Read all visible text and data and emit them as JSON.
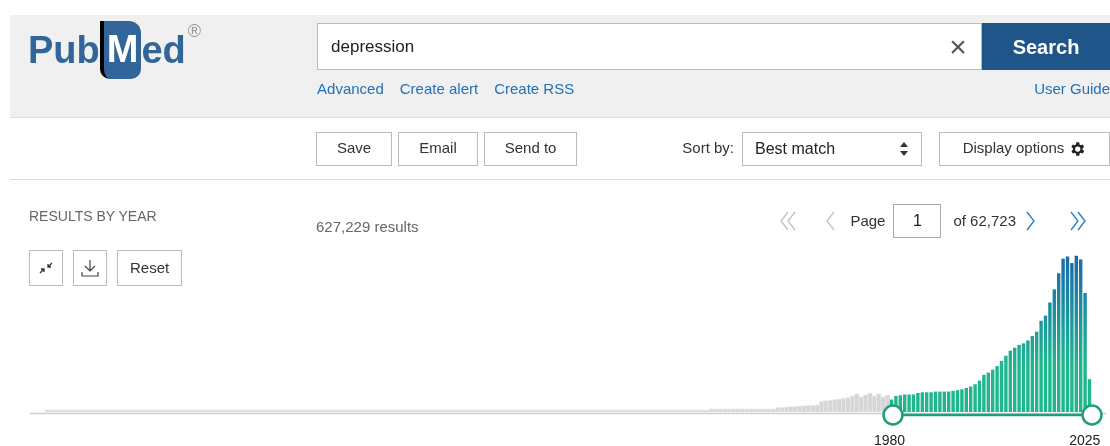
{
  "logo": {
    "left": "Pub",
    "mark": "M",
    "right": "ed",
    "registered": "®"
  },
  "search": {
    "value": "depression",
    "clear": "×",
    "button": "Search"
  },
  "links": [
    "Advanced",
    "Create alert",
    "Create RSS"
  ],
  "user_guide": "User Guide",
  "actions": [
    "Save",
    "Email",
    "Send to"
  ],
  "sort": {
    "label": "Sort by:",
    "value": "Best match"
  },
  "display_options": "Display options",
  "results_by_year": {
    "title": "RESULTS BY YEAR",
    "reset": "Reset",
    "start_label": "1980",
    "end_label": "2025"
  },
  "results_count": "627,229 results",
  "pagination": {
    "page_label": "Page",
    "page": "1",
    "of": "of 62,723",
    "first_disabled": true,
    "prev_disabled": true,
    "next_disabled": false,
    "last_disabled": false
  }
}
